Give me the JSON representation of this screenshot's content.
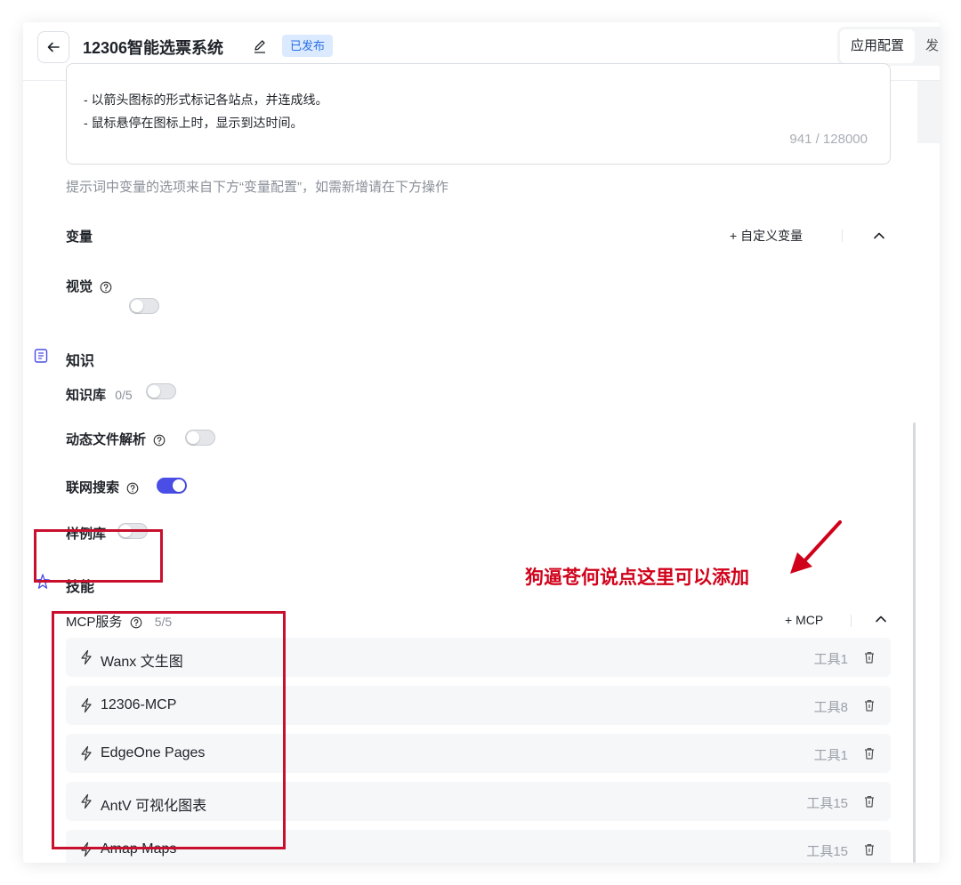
{
  "header": {
    "title": "12306智能选票系统",
    "status": "已发布",
    "tabs": [
      "应用配置",
      "发"
    ]
  },
  "prompt": {
    "lines": [
      "- 以箭头图标的形式标记各站点，并连成线。",
      "- 鼠标悬停在图标上时，显示到达时间。"
    ],
    "char_count": "941 / 128000",
    "hint": "提示词中变量的选项来自下方“变量配置”，如需新增请在下方操作"
  },
  "variables": {
    "label": "变量",
    "add_label": "+ 自定义变量"
  },
  "vision": {
    "label": "视觉",
    "enabled": false
  },
  "knowledge": {
    "title": "知识",
    "kb_label": "知识库",
    "kb_count": "0/5",
    "kb_enabled": false,
    "dynamic_file_label": "动态文件解析",
    "dynamic_file_enabled": false,
    "web_search_label": "联网搜索",
    "web_search_enabled": true,
    "examples_label": "样例库",
    "examples_enabled": false
  },
  "skills": {
    "title": "技能",
    "mcp_label": "MCP服务",
    "mcp_count": "5/5",
    "add_mcp_label": "+ MCP",
    "items": [
      {
        "name": "Wanx 文生图",
        "tools": "工具1"
      },
      {
        "name": "12306-MCP",
        "tools": "工具8"
      },
      {
        "name": "EdgeOne Pages",
        "tools": "工具1"
      },
      {
        "name": "AntV 可视化图表",
        "tools": "工具15"
      },
      {
        "name": "Amap Maps",
        "tools": "工具15"
      }
    ]
  },
  "annotation": {
    "text": "狗逼苍何说点这里可以添加",
    "color": "#d0021b"
  },
  "colors": {
    "accent": "#4a4ee6",
    "badge_bg": "#dbeafe",
    "badge_text": "#2b6fe6",
    "annotation_box": "#c8102e"
  }
}
